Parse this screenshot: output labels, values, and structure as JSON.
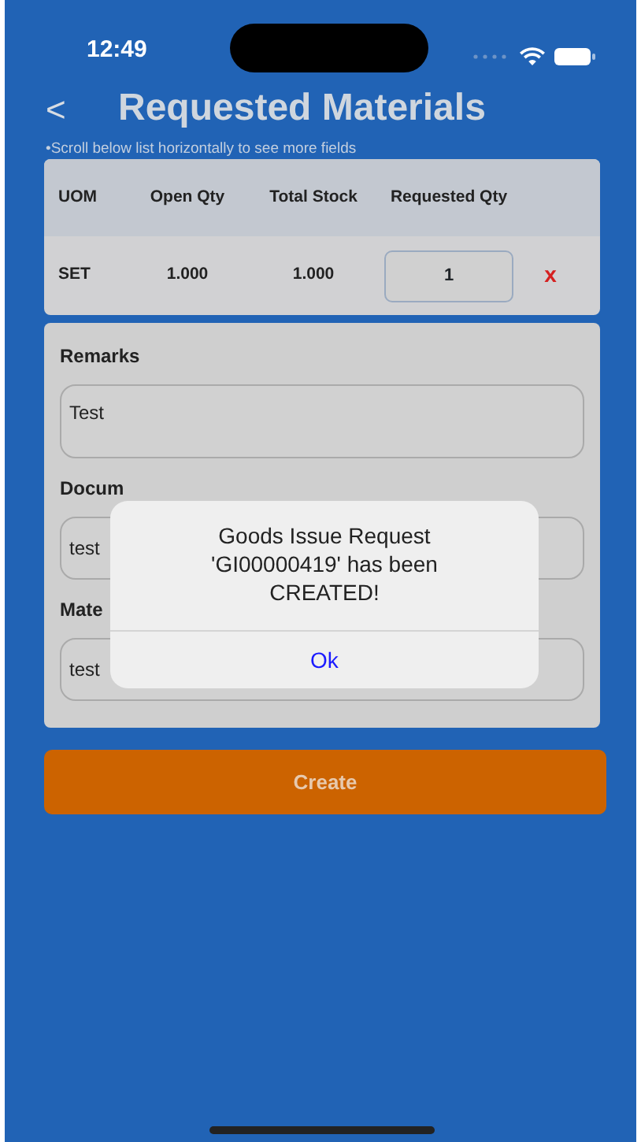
{
  "status_bar": {
    "time": "12:49"
  },
  "header": {
    "back": "<",
    "title": "Requested Materials"
  },
  "note": "•Scroll below list horizontally to see more fields",
  "table": {
    "columns": [
      "UOM",
      "Open Qty",
      "Total Stock",
      "Requested Qty"
    ],
    "rows": [
      {
        "uom": "SET",
        "open_qty": "1.000",
        "total_stock": "1.000",
        "requested_qty": "1",
        "remove": "x"
      }
    ]
  },
  "form": {
    "fields": [
      {
        "label": "Remarks",
        "value": "Test",
        "kind": "textarea"
      },
      {
        "label": "Docum",
        "value": "test",
        "kind": "input"
      },
      {
        "label": "Mate",
        "value": "test",
        "kind": "input"
      }
    ]
  },
  "create_button": "Create",
  "alert": {
    "message": "Goods Issue Request 'GI00000419' has been CREATED!",
    "button": "Ok"
  }
}
